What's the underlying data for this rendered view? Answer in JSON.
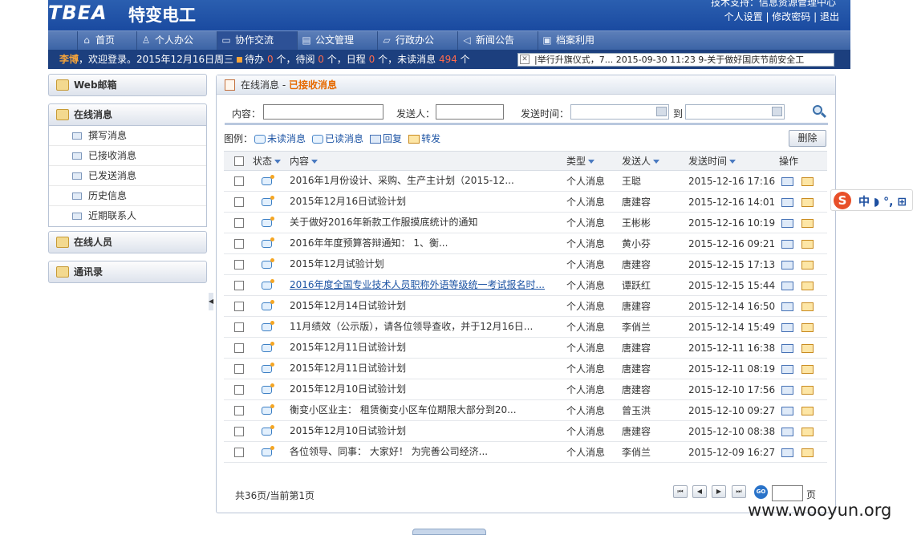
{
  "header": {
    "logo": "TBEA",
    "logo_cn": "特变电工",
    "support": "技术支持：信息资源管理中心",
    "links": [
      "个人设置",
      "修改密码",
      "退出"
    ]
  },
  "nav": [
    {
      "label": "首页",
      "icon": "home-icon"
    },
    {
      "label": "个人办公",
      "icon": "user-icon"
    },
    {
      "label": "协作交流",
      "icon": "chat-icon"
    },
    {
      "label": "公文管理",
      "icon": "document-icon"
    },
    {
      "label": "行政办公",
      "icon": "folder-icon"
    },
    {
      "label": "新闻公告",
      "icon": "speaker-icon"
    },
    {
      "label": "档案利用",
      "icon": "archive-icon"
    }
  ],
  "statusbar": {
    "user": "李博",
    "welcome": "，欢迎登录。2015年12月16日周三",
    "todo_label": "待办",
    "todo": "0",
    "unit": "个",
    "read_label": "，待阅",
    "read": "0",
    "sched_label": "，日程",
    "sched": "0",
    "unread_label": "，未读消息",
    "unread": "494",
    "ticker": "|举行升旗仪式，7...        2015-09-30 11:23  9-关于做好国庆节前安全工"
  },
  "sidebar": {
    "panels": [
      "Web邮箱",
      "在线消息",
      "在线人员",
      "通讯录"
    ],
    "message_items": [
      "撰写消息",
      "已接收消息",
      "已发送消息",
      "历史信息",
      "近期联系人"
    ]
  },
  "main": {
    "breadcrumb_prefix": "在线消息 - ",
    "breadcrumb_current": "已接收消息",
    "form": {
      "content_label": "内容：",
      "sender_label": "发送人：",
      "time_label": "发送时间：",
      "to_label": "到"
    },
    "legend": {
      "prefix": "图例：",
      "unread": "未读消息",
      "read": "已读消息",
      "reply": "回复",
      "forward": "转发"
    },
    "delete_label": "删除",
    "columns": [
      "状态",
      "内容",
      "类型",
      "发送人",
      "发送时间",
      "操作"
    ],
    "rows": [
      {
        "content": "2016年1月份设计、采购、生产主计划（2015-12...",
        "type": "个人消息",
        "sender": "王聪",
        "time": "2015-12-16 17:16"
      },
      {
        "content": "2015年12月16日试验计划",
        "type": "个人消息",
        "sender": "唐建容",
        "time": "2015-12-16 14:01"
      },
      {
        "content": "关于做好2016年新款工作服摸底统计的通知",
        "type": "个人消息",
        "sender": "王彬彬",
        "time": "2015-12-16 10:19"
      },
      {
        "content": "2016年年度预算答辩通知： 1、衡...",
        "type": "个人消息",
        "sender": "黄小芬",
        "time": "2015-12-16 09:21"
      },
      {
        "content": "2015年12月试验计划",
        "type": "个人消息",
        "sender": "唐建容",
        "time": "2015-12-15 17:13"
      },
      {
        "content": "2016年度全国专业技术人员职称外语等级统一考试报名时...",
        "type": "个人消息",
        "sender": "谭跃红",
        "time": "2015-12-15 15:44",
        "link": true
      },
      {
        "content": "2015年12月14日试验计划",
        "type": "个人消息",
        "sender": "唐建容",
        "time": "2015-12-14 16:50"
      },
      {
        "content": "11月绩效（公示版），请各位领导查收，并于12月16日...",
        "type": "个人消息",
        "sender": "李俏兰",
        "time": "2015-12-14 15:49"
      },
      {
        "content": "2015年12月11日试验计划",
        "type": "个人消息",
        "sender": "唐建容",
        "time": "2015-12-11 16:38"
      },
      {
        "content": "2015年12月11日试验计划",
        "type": "个人消息",
        "sender": "唐建容",
        "time": "2015-12-11 08:19"
      },
      {
        "content": "2015年12月10日试验计划",
        "type": "个人消息",
        "sender": "唐建容",
        "time": "2015-12-10 17:56"
      },
      {
        "content": "衡变小区业主： 租赁衡变小区车位期限大部分到20...",
        "type": "个人消息",
        "sender": "曾玉洪",
        "time": "2015-12-10 09:27"
      },
      {
        "content": "2015年12月10日试验计划",
        "type": "个人消息",
        "sender": "唐建容",
        "time": "2015-12-10 08:38"
      },
      {
        "content": "各位领导、同事： 大家好！ 为完善公司经济...",
        "type": "个人消息",
        "sender": "李俏兰",
        "time": "2015-12-09 16:27"
      }
    ],
    "pager": {
      "summary": "共36页/当前第1页",
      "page_label": "页",
      "go": "GO",
      "first": "⏮",
      "prev": "◀",
      "next": "▶",
      "last": "⏭"
    }
  },
  "overlay": {
    "sogou_text": "中 ◗ °, ⊞",
    "watermark": "www.wooyun.org"
  }
}
